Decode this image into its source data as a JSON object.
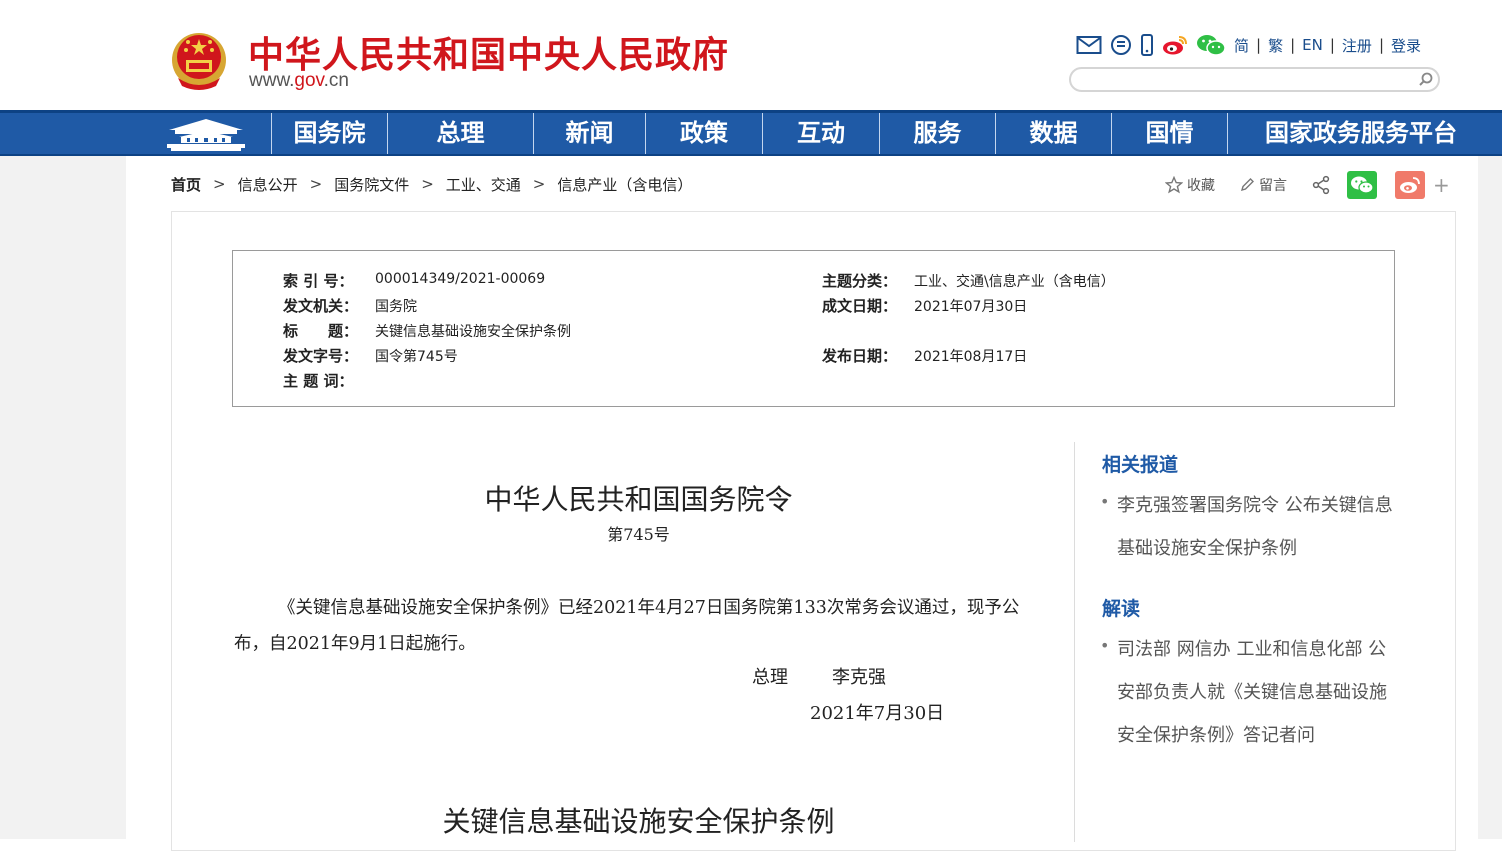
{
  "header": {
    "site_title": "中华人民共和国中央人民政府",
    "site_url_prefix": "www.",
    "site_url_gov": "gov",
    "site_url_suffix": ".cn",
    "top_links": [
      "简",
      "繁",
      "EN",
      "注册",
      "登录"
    ],
    "search_placeholder": ""
  },
  "nav": {
    "items": [
      "国务院",
      "总理",
      "新闻",
      "政策",
      "互动",
      "服务",
      "数据",
      "国情",
      "国家政务服务平台"
    ]
  },
  "breadcrumb": [
    "首页",
    "信息公开",
    "国务院文件",
    "工业、交通",
    "信息产业（含电信）"
  ],
  "tools": {
    "favorite": "收藏",
    "comment": "留言",
    "more": "+"
  },
  "info": {
    "index_label": "索 引 号：",
    "index_value": "000014349/2021-00069",
    "issuer_label": "发文机关：",
    "issuer_value": "国务院",
    "title_label": "标　　题：",
    "title_value": "关键信息基础设施安全保护条例",
    "docno_label": "发文字号：",
    "docno_value": "国令第745号",
    "subject_label": "主 题 词：",
    "subject_value": "",
    "category_label": "主题分类：",
    "category_value": "工业、交通\\信息产业（含电信）",
    "written_label": "成文日期：",
    "written_value": "2021年07月30日",
    "published_label": "发布日期：",
    "published_value": "2021年08月17日"
  },
  "document": {
    "title": "中华人民共和国国务院令",
    "number": "第745号",
    "paragraph": "《关键信息基础设施安全保护条例》已经2021年4月27日国务院第133次常务会议通过，现予公布，自2021年9月1日起施行。",
    "signer_role": "总理",
    "signer_name": "李克强",
    "date": "2021年7月30日",
    "subtitle": "关键信息基础设施安全保护条例"
  },
  "sidebar": {
    "related_heading": "相关报道",
    "related_link": "李克强签署国务院令 公布关键信息基础设施安全保护条例",
    "interpret_heading": "解读",
    "interpret_link": "司法部 网信办 工业和信息化部 公安部负责人就《关键信息基础设施安全保护条例》答记者问"
  },
  "colors": {
    "brand_red": "#d0161c",
    "nav_blue": "#1f5aa6",
    "link_blue": "#1a4d8c",
    "wechat_green": "#2fbf45",
    "weibo_orange": "#f07a6a"
  }
}
